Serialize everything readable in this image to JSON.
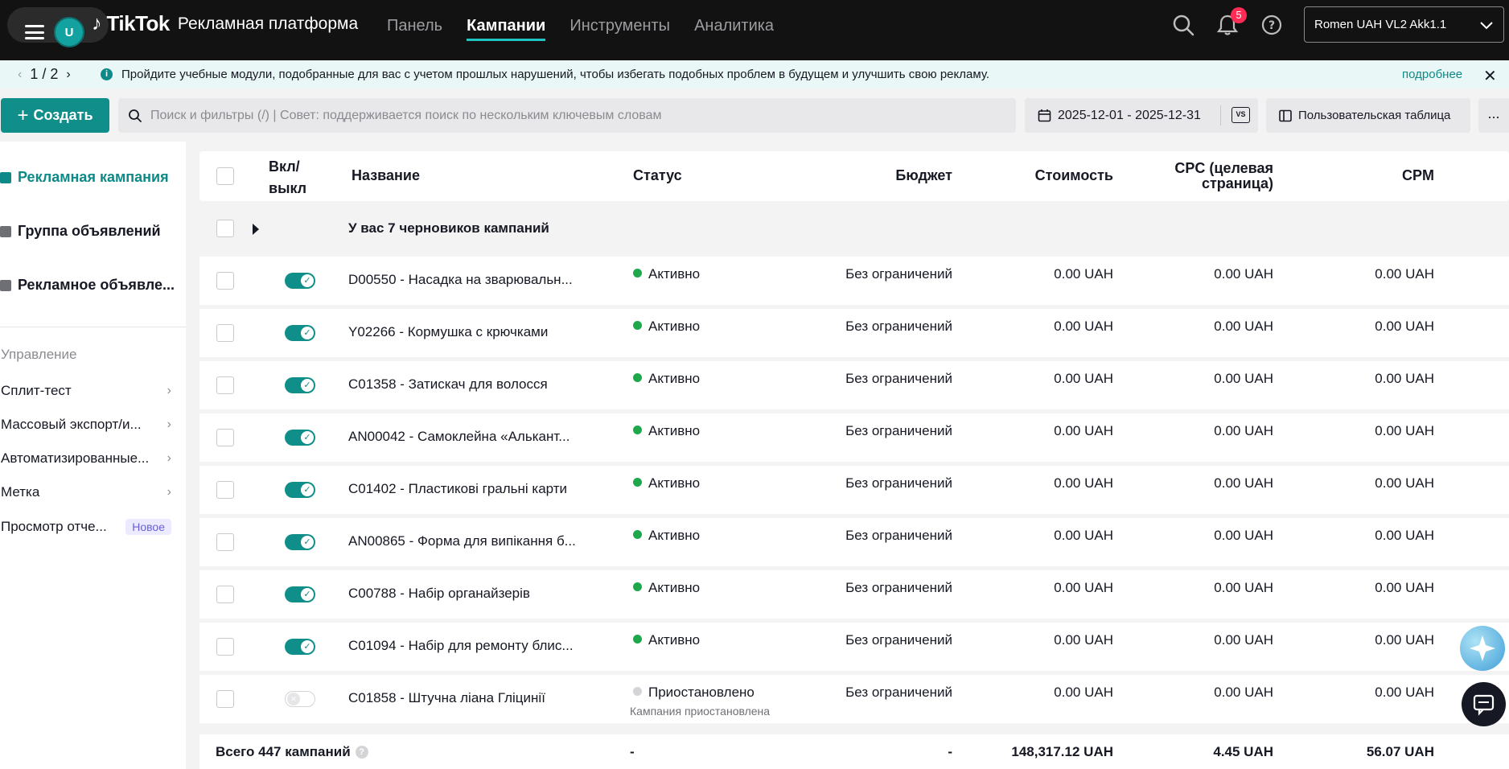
{
  "topbar": {
    "avatar": "U",
    "brand": "TikTok",
    "brand_sub": "Рекламная платформа",
    "nav": [
      "Панель",
      "Кампании",
      "Инструменты",
      "Аналитика"
    ],
    "active_nav": "Кампании",
    "notifications": "5",
    "account": "Romen UAH VL2 Akk1.1"
  },
  "notice": {
    "pager": "1 / 2",
    "message": "Пройдите учебные модули, подобранные для вас с учетом прошлых нарушений, чтобы избегать подобных проблем в будущем и улучшить свою рекламу.",
    "more": "подробнее"
  },
  "toolbar": {
    "create": "Создать",
    "search_placeholder": "Поиск и фильтры (/) | Совет: поддерживается поиск по нескольким ключевым словам",
    "date_range": "2025-12-01 - 2025-12-31",
    "compare": "VS",
    "custom_table": "Пользовательская таблица",
    "more": "..."
  },
  "sidebar": {
    "levels": [
      "Рекламная кампания",
      "Группа объявлений",
      "Рекламное объявле..."
    ],
    "section": "Управление",
    "links": [
      "Сплит-тест",
      "Массовый экспорт/и...",
      "Автоматизированные...",
      "Метка",
      "Просмотр отче..."
    ],
    "new_badge": "Новое"
  },
  "table": {
    "headers": {
      "toggle": "Вкл/ выкл",
      "name": "Название",
      "status": "Статус",
      "budget": "Бюджет",
      "cost": "Стоимость",
      "cpc": "CPC (целевая страница)",
      "cpm": "CPM"
    },
    "drafts": "У вас 7 черновиков кампаний",
    "rows": [
      {
        "on": true,
        "name": "D00550 - Насадка на зварювальн...",
        "status": "Активно",
        "budget": "Без ограничений",
        "cost": "0.00 UAH",
        "cpc": "0.00 UAH",
        "cpm": "0.00 UAH"
      },
      {
        "on": true,
        "name": "Y02266 - Кормушка с крючками",
        "status": "Активно",
        "budget": "Без ограничений",
        "cost": "0.00 UAH",
        "cpc": "0.00 UAH",
        "cpm": "0.00 UAH"
      },
      {
        "on": true,
        "name": "C01358 - Затискач для волосся",
        "status": "Активно",
        "budget": "Без ограничений",
        "cost": "0.00 UAH",
        "cpc": "0.00 UAH",
        "cpm": "0.00 UAH"
      },
      {
        "on": true,
        "name": "AN00042 - Самоклейна «Алькант...",
        "status": "Активно",
        "budget": "Без ограничений",
        "cost": "0.00 UAH",
        "cpc": "0.00 UAH",
        "cpm": "0.00 UAH"
      },
      {
        "on": true,
        "name": "C01402 - Пластикові гральні карти",
        "status": "Активно",
        "budget": "Без ограничений",
        "cost": "0.00 UAH",
        "cpc": "0.00 UAH",
        "cpm": "0.00 UAH"
      },
      {
        "on": true,
        "name": "AN00865 - Форма для випікання б...",
        "status": "Активно",
        "budget": "Без ограничений",
        "cost": "0.00 UAH",
        "cpc": "0.00 UAH",
        "cpm": "0.00 UAH"
      },
      {
        "on": true,
        "name": "C00788 - Набір органайзерів",
        "status": "Активно",
        "budget": "Без ограничений",
        "cost": "0.00 UAH",
        "cpc": "0.00 UAH",
        "cpm": "0.00 UAH"
      },
      {
        "on": true,
        "name": "C01094 - Набір для ремонту блис...",
        "status": "Активно",
        "budget": "Без ограничений",
        "cost": "0.00 UAH",
        "cpc": "0.00 UAH",
        "cpm": "0.00 UAH"
      },
      {
        "on": false,
        "name": "C01858 - Штучна ліана Гліцинії",
        "status": "Приостановлено",
        "status_sub": "Кампания приостановлена",
        "budget": "Без ограничений",
        "cost": "0.00 UAH",
        "cpc": "0.00 UAH",
        "cpm": "0.00 UAH"
      }
    ],
    "total": {
      "label": "Всего 447 кампаний",
      "status": "-",
      "budget": "-",
      "cost": "148,317.12 UAH",
      "cpc": "4.45 UAH",
      "cpm": "56.07 UAH"
    }
  },
  "colors": {
    "accent": "#0f8e8a",
    "topbar": "#121212",
    "active_status": "#1fa74c"
  }
}
